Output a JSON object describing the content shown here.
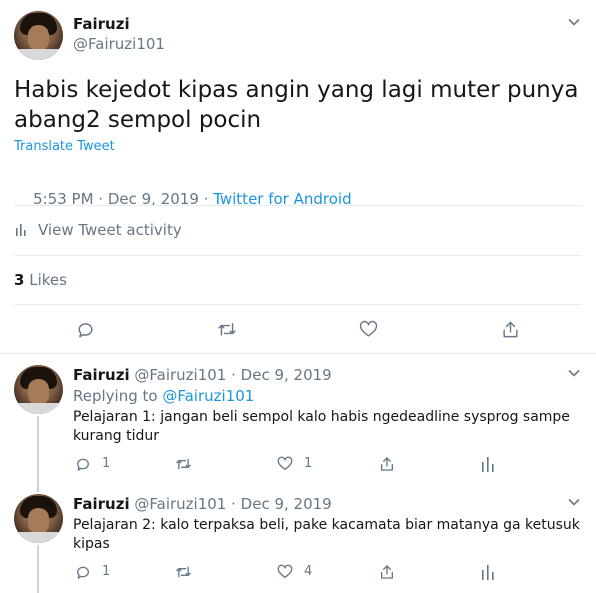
{
  "main_tweet": {
    "author_name": "Fairuzi",
    "author_handle": "@Fairuzi101",
    "text_line1": "Habis kejedot kipas angin yang lagi muter punya",
    "text_line2": "abang2 sempol pocin",
    "translate": "Translate Tweet",
    "time": "5:53 PM · Dec 9, 2019 · ",
    "source": "Twitter for Android",
    "activity": "View Tweet activity",
    "likes_count": "3",
    "likes_label": "Likes"
  },
  "replies": [
    {
      "author_name": "Fairuzi",
      "author_handle": "@Fairuzi101",
      "dot_date": "· Dec 9, 2019",
      "replying_label": "Replying to ",
      "replying_handle": "@Fairuzi101",
      "text_line1": "Pelajaran 1: jangan beli sempol kalo habis ngedeadline sysprog sampe",
      "text_line2": "kurang tidur",
      "reply_count": "1",
      "retweet_count": "",
      "like_count": "1"
    },
    {
      "author_name": "Fairuzi",
      "author_handle": "@Fairuzi101",
      "dot_date": "· Dec 9, 2019",
      "text_line1": "Pelajaran 2: kalo terpaksa beli, pake kacamata biar matanya ga ketusuk",
      "text_line2": "kipas",
      "reply_count": "1",
      "retweet_count": "",
      "like_count": "4"
    }
  ],
  "colors": {
    "link": "#1b95e0",
    "muted": "#657786",
    "text": "#14171a",
    "divider": "#e6ecf0"
  },
  "icons": [
    "chevron-down-icon",
    "bar-chart-icon",
    "reply-icon",
    "retweet-icon",
    "like-icon",
    "share-icon",
    "analytics-icon"
  ]
}
